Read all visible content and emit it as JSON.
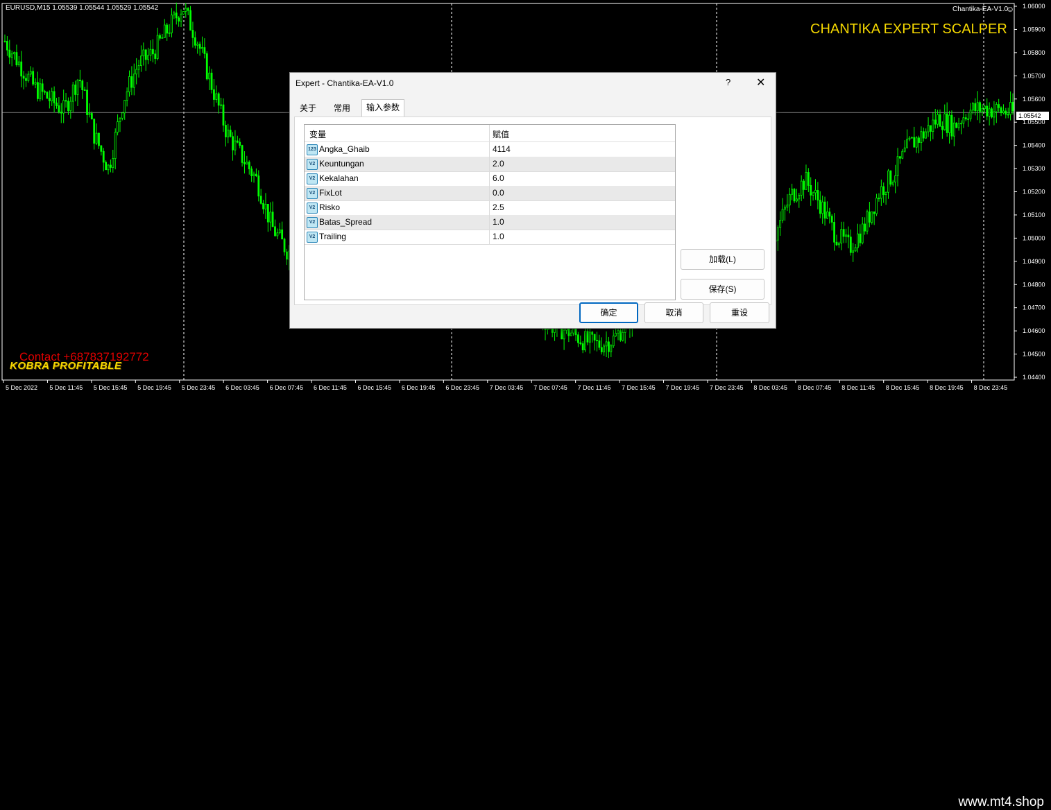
{
  "chart": {
    "symbol_info": "EURUSD,M15  1.05539 1.05544 1.05529 1.05542",
    "ea_label": "Chantika-EA-V1.0",
    "ea_status_icon": "smiley-icon",
    "title_overlay": "CHANTIKA EXPERT SCALPER",
    "contact": "Contact +687837192772",
    "brand": "KOBRA PROFITABLE",
    "watermark": "www.mt4.shop",
    "current_price": "1.05542",
    "price_axis": [
      "1.06000",
      "1.05900",
      "1.05800",
      "1.05700",
      "1.05600",
      "1.05500",
      "1.05400",
      "1.05300",
      "1.05200",
      "1.05100",
      "1.05000",
      "1.04900",
      "1.04800",
      "1.04700",
      "1.04600",
      "1.04500",
      "1.04400"
    ],
    "time_axis": [
      "5 Dec 2022",
      "5 Dec 11:45",
      "5 Dec 15:45",
      "5 Dec 19:45",
      "5 Dec 23:45",
      "6 Dec 03:45",
      "6 Dec 07:45",
      "6 Dec 11:45",
      "6 Dec 15:45",
      "6 Dec 19:45",
      "6 Dec 23:45",
      "7 Dec 03:45",
      "7 Dec 07:45",
      "7 Dec 11:45",
      "7 Dec 15:45",
      "7 Dec 19:45",
      "7 Dec 23:45",
      "8 Dec 03:45",
      "8 Dec 07:45",
      "8 Dec 11:45",
      "8 Dec 15:45",
      "8 Dec 19:45",
      "8 Dec 23:45"
    ],
    "colors": {
      "background": "#000000",
      "candles": "#00ff00",
      "grid": "#ffffff",
      "title": "#f5d800",
      "contact": "#e00000"
    }
  },
  "chart_data": {
    "type": "candlestick",
    "ylim": [
      1.044,
      1.06
    ],
    "grid": "vertical dashed at day boundaries",
    "price_path": [
      1.0585,
      1.0575,
      1.0565,
      1.056,
      1.0555,
      1.057,
      1.0545,
      1.053,
      1.056,
      1.0575,
      1.058,
      1.059,
      1.06,
      1.0585,
      1.0565,
      1.0545,
      1.0535,
      1.0525,
      1.0505,
      1.0495,
      1.049,
      1.0485,
      1.0488,
      1.0495,
      1.0502,
      1.051,
      1.0515,
      1.0508,
      1.0498,
      1.049,
      1.0485,
      1.0482,
      1.048,
      1.0478,
      1.0474,
      1.047,
      1.0466,
      1.0462,
      1.046,
      1.0456,
      1.0454,
      1.0456,
      1.0464,
      1.047,
      1.0476,
      1.0482,
      1.0488,
      1.0494,
      1.0498,
      1.0502,
      1.0504,
      1.0498,
      1.0502,
      1.0518,
      1.0525,
      1.0515,
      1.0502,
      1.0496,
      1.0505,
      1.052,
      1.0528,
      1.054,
      1.0545,
      1.0552,
      1.0548,
      1.0555,
      1.0556,
      1.0555,
      1.0554
    ]
  },
  "dialog": {
    "title": "Expert - Chantika-EA-V1.0",
    "help": "?",
    "close": "✕",
    "tabs": [
      "关于",
      "常用",
      "输入参数"
    ],
    "active_tab": "输入参数",
    "columns": [
      "变量",
      "赋值"
    ],
    "params": [
      {
        "icon": "123",
        "name": "Angka_Ghaib",
        "value": "4114"
      },
      {
        "icon": "V2",
        "name": "Keuntungan",
        "value": "2.0"
      },
      {
        "icon": "V2",
        "name": "Kekalahan",
        "value": "6.0"
      },
      {
        "icon": "V2",
        "name": "FixLot",
        "value": "0.0"
      },
      {
        "icon": "V2",
        "name": "Risko",
        "value": "2.5"
      },
      {
        "icon": "V2",
        "name": "Batas_Spread",
        "value": "1.0"
      },
      {
        "icon": "V2",
        "name": "Trailing",
        "value": "1.0"
      }
    ],
    "buttons": {
      "load": "加载(L)",
      "save": "保存(S)",
      "ok": "确定",
      "cancel": "取消",
      "reset": "重设"
    }
  }
}
